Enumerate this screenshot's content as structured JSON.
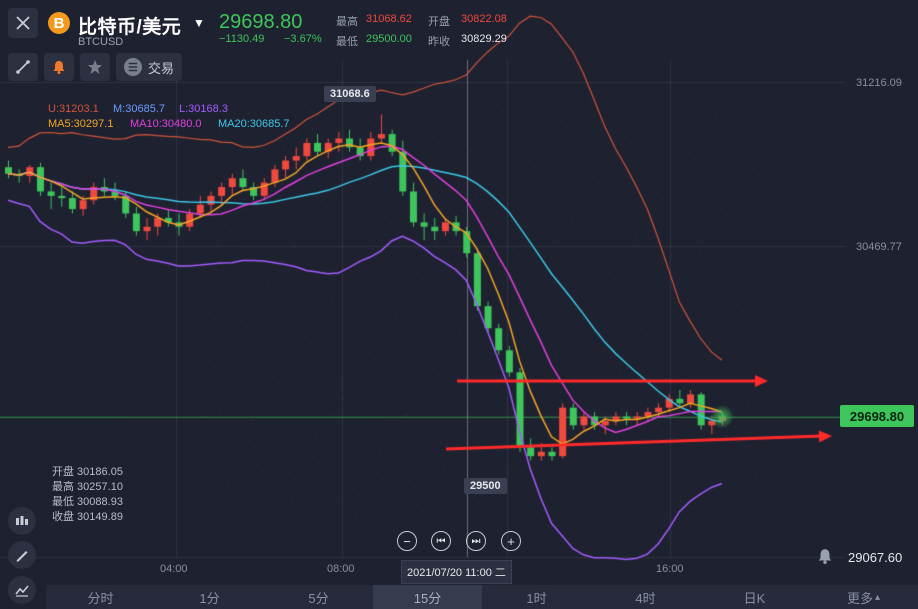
{
  "header": {
    "title": "比特币/美元",
    "symbol": "BTCUSD",
    "logo_glyph": "B",
    "price": "29698.80",
    "change": "−1130.49",
    "change_pct": "−3.67%",
    "high_label": "最高",
    "high_value": "31068.62",
    "open_label": "开盘",
    "open_value": "30822.08",
    "low_label": "最低",
    "low_value": "29500.00",
    "prev_close_label": "昨收",
    "prev_close_value": "30829.29"
  },
  "toolbar": {
    "trade_label": "交易",
    "trade_icon_glyph": "☰"
  },
  "indicators": {
    "boll_upper": "U:31203.1",
    "boll_mid": "M:30685.7",
    "boll_lower": "L:30168.3",
    "ma5": "MA5:30297.1",
    "ma10": "MA10:30480.0",
    "ma20": "MA20:30685.7"
  },
  "ohlc_panel": {
    "open": "开盘  30186.05",
    "high": "最高  30257.10",
    "low": "最低  30088.93",
    "close": "收盘  30149.89"
  },
  "price_axis": {
    "ticks": [
      "31216.09",
      "30469.77",
      "29067.60"
    ],
    "current": "29698.80"
  },
  "time_axis": {
    "ticks": [
      "04:00",
      "08:00",
      "16:00"
    ],
    "cursor": "2021/07/20 11:00 二"
  },
  "callouts": {
    "high": "31068.6",
    "low": "29500"
  },
  "playback": {
    "zoom_out": "−",
    "prev": "⏮",
    "next": "⏭",
    "zoom_in": "+"
  },
  "tabs": [
    {
      "label": "分时"
    },
    {
      "label": "1分"
    },
    {
      "label": "5分"
    },
    {
      "label": "15分"
    },
    {
      "label": "1时"
    },
    {
      "label": "4时"
    },
    {
      "label": "日K"
    },
    {
      "label": "更多"
    }
  ],
  "active_tab": "15分",
  "more_caret": "▴",
  "colors": {
    "background": "#1e2130",
    "up": "#f0493e",
    "down": "#3ec55b",
    "boll_band": "#a45cff",
    "boll_upper": "#d0553a",
    "ma5": "#f5a623",
    "ma10": "#e040e0",
    "ma20": "#3cc8e8",
    "arrow": "#ff2a2a"
  },
  "chart_data": {
    "type": "candlestick",
    "interval": "15m",
    "ylim": [
      29067.6,
      31216.09
    ],
    "candles": [
      [
        30830,
        30860,
        30780,
        30800
      ],
      [
        30800,
        30820,
        30760,
        30790
      ],
      [
        30790,
        30840,
        30760,
        30830
      ],
      [
        30830,
        30850,
        30700,
        30720
      ],
      [
        30720,
        30760,
        30640,
        30700
      ],
      [
        30700,
        30740,
        30650,
        30690
      ],
      [
        30690,
        30720,
        30620,
        30640
      ],
      [
        30640,
        30700,
        30610,
        30680
      ],
      [
        30680,
        30760,
        30660,
        30740
      ],
      [
        30740,
        30780,
        30700,
        30720
      ],
      [
        30720,
        30760,
        30680,
        30700
      ],
      [
        30700,
        30720,
        30600,
        30620
      ],
      [
        30620,
        30650,
        30520,
        30540
      ],
      [
        30540,
        30600,
        30500,
        30560
      ],
      [
        30560,
        30620,
        30520,
        30600
      ],
      [
        30600,
        30640,
        30560,
        30580
      ],
      [
        30580,
        30620,
        30520,
        30560
      ],
      [
        30560,
        30640,
        30540,
        30620
      ],
      [
        30620,
        30700,
        30600,
        30660
      ],
      [
        30660,
        30720,
        30620,
        30700
      ],
      [
        30700,
        30760,
        30660,
        30740
      ],
      [
        30740,
        30800,
        30700,
        30780
      ],
      [
        30780,
        30820,
        30720,
        30740
      ],
      [
        30740,
        30760,
        30680,
        30700
      ],
      [
        30700,
        30780,
        30680,
        30760
      ],
      [
        30760,
        30840,
        30740,
        30820
      ],
      [
        30820,
        30880,
        30780,
        30860
      ],
      [
        30860,
        30920,
        30820,
        30880
      ],
      [
        30880,
        30960,
        30860,
        30940
      ],
      [
        30940,
        30980,
        30880,
        30900
      ],
      [
        30900,
        30960,
        30870,
        30940
      ],
      [
        30940,
        30990,
        30900,
        30960
      ],
      [
        30960,
        31000,
        30900,
        30920
      ],
      [
        30920,
        30960,
        30860,
        30880
      ],
      [
        30880,
        30990,
        30860,
        30960
      ],
      [
        30960,
        31069,
        30940,
        30980
      ],
      [
        30980,
        31000,
        30880,
        30900
      ],
      [
        30900,
        30950,
        30700,
        30720
      ],
      [
        30720,
        30760,
        30560,
        30580
      ],
      [
        30580,
        30620,
        30500,
        30560
      ],
      [
        30560,
        30600,
        30500,
        30540
      ],
      [
        30540,
        30600,
        30520,
        30580
      ],
      [
        30580,
        30610,
        30520,
        30540
      ],
      [
        30540,
        30560,
        30420,
        30440
      ],
      [
        30440,
        30460,
        30180,
        30200
      ],
      [
        30200,
        30220,
        30080,
        30100
      ],
      [
        30100,
        30120,
        29980,
        30000
      ],
      [
        30000,
        30020,
        29880,
        29900
      ],
      [
        29900,
        29920,
        29540,
        29560
      ],
      [
        29560,
        29600,
        29500,
        29520
      ],
      [
        29520,
        29580,
        29500,
        29540
      ],
      [
        29540,
        29560,
        29500,
        29520
      ],
      [
        29520,
        29760,
        29510,
        29740
      ],
      [
        29740,
        29760,
        29640,
        29660
      ],
      [
        29660,
        29720,
        29640,
        29700
      ],
      [
        29700,
        29720,
        29640,
        29660
      ],
      [
        29660,
        29700,
        29620,
        29680
      ],
      [
        29680,
        29720,
        29660,
        29700
      ],
      [
        29700,
        29720,
        29660,
        29690
      ],
      [
        29690,
        29720,
        29660,
        29700
      ],
      [
        29700,
        29740,
        29680,
        29720
      ],
      [
        29720,
        29760,
        29700,
        29740
      ],
      [
        29740,
        29800,
        29720,
        29780
      ],
      [
        29780,
        29820,
        29740,
        29760
      ],
      [
        29760,
        29820,
        29740,
        29800
      ],
      [
        29800,
        29810,
        29640,
        29660
      ],
      [
        29660,
        29700,
        29620,
        29680
      ],
      [
        29680,
        29720,
        29660,
        29700
      ]
    ]
  }
}
